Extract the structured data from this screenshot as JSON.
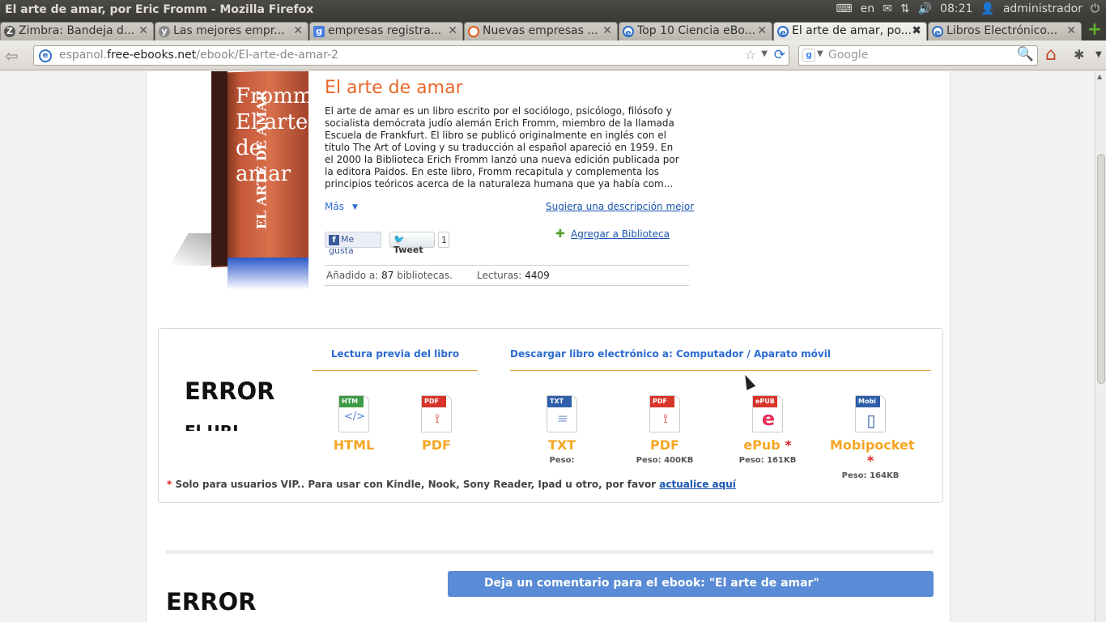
{
  "window": {
    "title": "El arte de amar, por Eric Fromm - Mozilla Firefox"
  },
  "tray": {
    "keyboard_layout": "en",
    "time": "08:21",
    "user": "administrador"
  },
  "tabs": [
    {
      "label": "Zimbra: Bandeja d...",
      "icon": "zimbra-icon",
      "active": false
    },
    {
      "label": "Las mejores empr...",
      "icon": "y-icon",
      "active": false
    },
    {
      "label": "empresas registra...",
      "icon": "google-icon",
      "active": false
    },
    {
      "label": "Nuevas empresas ...",
      "icon": "ring-icon",
      "active": false
    },
    {
      "label": "Top 10 Ciencia eBo...",
      "icon": "ebook-icon",
      "active": false
    },
    {
      "label": "El arte de amar, po...",
      "icon": "ebook-icon",
      "active": true
    },
    {
      "label": "Libros Electrónico...",
      "icon": "ebook-icon",
      "active": false
    }
  ],
  "urlbar": {
    "prefix": "espanol.",
    "host": "free-ebooks.net",
    "path": "/ebook/El-arte-de-amar-2"
  },
  "searchbar": {
    "placeholder": "Google"
  },
  "book": {
    "cover_title": "Fromm El arte de amar",
    "cover_spine": "EL ARTE DE AMAR",
    "title": "El arte de amar",
    "description": "El arte de amar es un libro escrito por el sociólogo, psicólogo, filósofo y socialista demócrata judío alemán Erich Fromm, miembro de la llamada Escuela de Frankfurt. El libro se publicó originalmente en inglés con el título The Art of Loving y su traducción al español apareció en 1959. En el 2000 la Biblioteca Erich Fromm lanzó una nueva edición publicada por la editora Paidos. En este libro, Fromm recapitula y complementa los principios teóricos acerca de la naturaleza humana que ya había com...",
    "more_label": "Más",
    "suggest_label": "Sugiera una descripción mejor",
    "fb_like_label": "Me gusta",
    "tweet_label": "Tweet",
    "tweet_count": "1",
    "add_library_label": "Agregar a Biblioteca",
    "added_label": "Añadido a:",
    "added_count": "87",
    "added_suffix": "bibliotecas.",
    "reads_label": "Lecturas:",
    "reads_count": "4409"
  },
  "download": {
    "error_text": "ERROR",
    "error_sub": "El URL",
    "preview_heading": "Lectura previa del libro",
    "download_heading": "Descargar libro electrónico a: Computador / Aparato móvil",
    "preview_formats": [
      {
        "name": "HTML",
        "tag": "HTM",
        "tag_color": "#3d9a45",
        "glyph": "</>"
      },
      {
        "name": "PDF",
        "tag": "PDF",
        "tag_color": "#d9342b",
        "glyph": "⟟"
      }
    ],
    "download_formats": [
      {
        "name": "TXT",
        "tag": "TXT",
        "tag_color": "#2f5fa8",
        "size": "Peso:",
        "vip": false,
        "glyph": "≡"
      },
      {
        "name": "PDF",
        "tag": "PDF",
        "tag_color": "#d9342b",
        "size": "Peso: 400KB",
        "vip": false,
        "glyph": "⟟"
      },
      {
        "name": "ePub",
        "tag": "ePUB",
        "tag_color": "#d9342b",
        "size": "Peso: 161KB",
        "vip": true,
        "glyph": "e"
      },
      {
        "name": "Mobipocket",
        "tag": "Mobi",
        "tag_color": "#2f5fa8",
        "size": "Peso: 164KB",
        "vip": true,
        "glyph": "▯"
      }
    ],
    "vip_star": "*",
    "vip_note": " Solo para usuarios VIP.. Para usar con Kindle, Nook, Sony Reader, Ipad u otro, por favor ",
    "vip_link": "actualice aquí"
  },
  "comments": {
    "error_text": "ERROR",
    "comment_button": "Deja un comentario para el ebook: \"El arte de amar\""
  }
}
